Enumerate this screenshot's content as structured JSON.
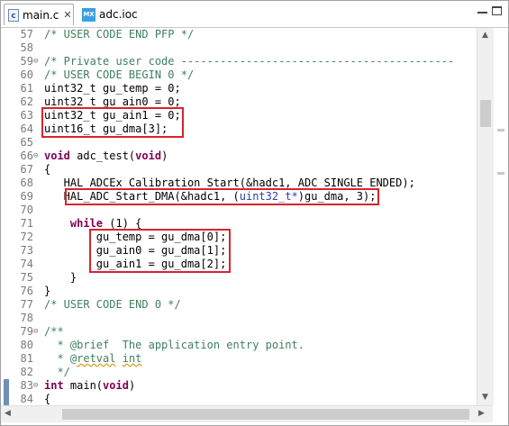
{
  "tabs": [
    {
      "label": "main.c",
      "icon": "c-file-icon",
      "active": true
    },
    {
      "label": "adc.ioc",
      "icon": "mx-icon",
      "icon_text": "MX",
      "active": false
    }
  ],
  "icons": {
    "c_letter": "c",
    "close": "✕"
  },
  "lines": [
    {
      "n": "57",
      "fold": "",
      "segs": [
        {
          "t": "/* USER CODE END PFP */",
          "c": "cm"
        }
      ]
    },
    {
      "n": "58",
      "fold": "",
      "segs": []
    },
    {
      "n": "59",
      "fold": "⊖",
      "segs": [
        {
          "t": "/* Private user code ------------------------------------------",
          "c": "cm"
        }
      ]
    },
    {
      "n": "60",
      "fold": "",
      "segs": [
        {
          "t": "/* USER CODE BEGIN 0 */",
          "c": "cm"
        }
      ]
    },
    {
      "n": "61",
      "fold": "",
      "segs": [
        {
          "t": "uint32_t gu_temp = 0;",
          "c": ""
        }
      ]
    },
    {
      "n": "62",
      "fold": "",
      "segs": [
        {
          "t": "uint32_t gu_ain0 = 0;",
          "c": ""
        }
      ]
    },
    {
      "n": "63",
      "fold": "",
      "segs": [
        {
          "t": "uint32_t gu_ain1 = 0;",
          "c": ""
        }
      ]
    },
    {
      "n": "64",
      "fold": "",
      "segs": [
        {
          "t": "uint16_t gu_dma[3];",
          "c": ""
        }
      ]
    },
    {
      "n": "65",
      "fold": "",
      "segs": []
    },
    {
      "n": "66",
      "fold": "⊖",
      "segs": [
        {
          "t": "void",
          "c": "kw"
        },
        {
          "t": " adc_test(",
          "c": ""
        },
        {
          "t": "void",
          "c": "kw"
        },
        {
          "t": ")",
          "c": ""
        }
      ]
    },
    {
      "n": "67",
      "fold": "",
      "segs": [
        {
          "t": "{",
          "c": ""
        }
      ]
    },
    {
      "n": "68",
      "fold": "",
      "segs": [
        {
          "t": "   HAL_ADCEx_Calibration_Start(&hadc1, ADC_SINGLE_ENDED);",
          "c": ""
        }
      ]
    },
    {
      "n": "69",
      "fold": "",
      "segs": [
        {
          "t": "   HAL_ADC_Start_DMA(&hadc1, (",
          "c": ""
        },
        {
          "t": "uint32_t*",
          "c": "cast"
        },
        {
          "t": ")gu_dma, 3);",
          "c": ""
        }
      ]
    },
    {
      "n": "70",
      "fold": "",
      "segs": []
    },
    {
      "n": "71",
      "fold": "",
      "segs": [
        {
          "t": "    ",
          "c": ""
        },
        {
          "t": "while",
          "c": "kw"
        },
        {
          "t": " (1) {",
          "c": ""
        }
      ]
    },
    {
      "n": "72",
      "fold": "",
      "segs": [
        {
          "t": "        gu_temp = gu_dma[0];",
          "c": ""
        }
      ]
    },
    {
      "n": "73",
      "fold": "",
      "segs": [
        {
          "t": "        gu_ain0 = gu_dma[1];",
          "c": ""
        }
      ]
    },
    {
      "n": "74",
      "fold": "",
      "segs": [
        {
          "t": "        gu_ain1 = gu_dma[2];",
          "c": ""
        }
      ]
    },
    {
      "n": "75",
      "fold": "",
      "segs": [
        {
          "t": "    }",
          "c": ""
        }
      ]
    },
    {
      "n": "76",
      "fold": "",
      "segs": [
        {
          "t": "}",
          "c": ""
        }
      ]
    },
    {
      "n": "77",
      "fold": "",
      "segs": [
        {
          "t": "/* USER CODE END 0 */",
          "c": "cm"
        }
      ]
    },
    {
      "n": "78",
      "fold": "",
      "segs": []
    },
    {
      "n": "79",
      "fold": "⊖",
      "segs": [
        {
          "t": "/**",
          "c": "cm"
        }
      ]
    },
    {
      "n": "80",
      "fold": "",
      "segs": [
        {
          "t": "  * @brief  The application entry point.",
          "c": "cm"
        }
      ]
    },
    {
      "n": "81",
      "fold": "",
      "segs": [
        {
          "t": "  * @",
          "c": "cm"
        },
        {
          "t": "retval",
          "c": "cm wavy"
        },
        {
          "t": " ",
          "c": "cm"
        },
        {
          "t": "int",
          "c": "cm wavy"
        }
      ]
    },
    {
      "n": "82",
      "fold": "",
      "segs": [
        {
          "t": "  */",
          "c": "cm"
        }
      ]
    },
    {
      "n": "83",
      "fold": "⊖",
      "segs": [
        {
          "t": "int",
          "c": "kw"
        },
        {
          "t": " main(",
          "c": ""
        },
        {
          "t": "void",
          "c": "kw"
        },
        {
          "t": ")",
          "c": ""
        }
      ]
    },
    {
      "n": "84",
      "fold": "",
      "segs": [
        {
          "t": "{",
          "c": ""
        }
      ]
    }
  ],
  "highlights": [
    {
      "name": "highlight-box-variables",
      "from_line": "63",
      "to_line": "64"
    },
    {
      "name": "highlight-box-dma-start",
      "from_line": "69",
      "to_line": "69"
    },
    {
      "name": "highlight-box-while-body",
      "from_line": "72",
      "to_line": "74"
    }
  ],
  "scroll_arrows": {
    "up": "▲",
    "down": "▼",
    "left": "◀",
    "right": "▶"
  }
}
